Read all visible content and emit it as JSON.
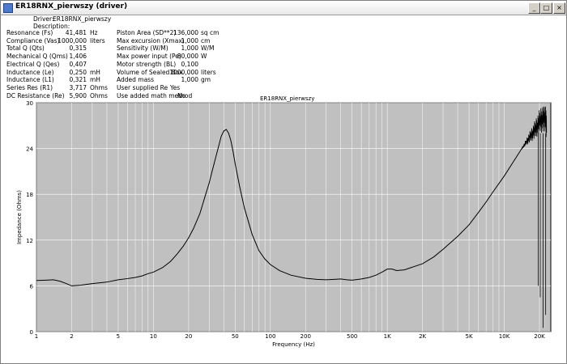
{
  "window": {
    "title": "ER18RNX_pierwszy (driver)",
    "minimize_label": "_",
    "maximize_label": "□",
    "close_label": "×"
  },
  "header": {
    "driver_label": "Driver:",
    "driver_value": "ER18RNX_pierwszy",
    "description_label": "Description:"
  },
  "params_left": [
    {
      "label": "Resonance (Fs)",
      "value": "41,481",
      "unit": "Hz"
    },
    {
      "label": "Compliance (Vas)",
      "value": "1000,000",
      "unit": "liters"
    },
    {
      "label": "Total Q (Qts)",
      "value": "0,315",
      "unit": ""
    },
    {
      "label": "Mechanical Q (Qms)",
      "value": "1,406",
      "unit": ""
    },
    {
      "label": "Electrical Q (Qes)",
      "value": "0,407",
      "unit": ""
    },
    {
      "label": "Inductance (Le)",
      "value": "0,250",
      "unit": "mH"
    },
    {
      "label": "Inductance (L1)",
      "value": "0,321",
      "unit": "mH"
    },
    {
      "label": "Series Res (R1)",
      "value": "3,717",
      "unit": "Ohms"
    },
    {
      "label": "DC Resistance (Re)",
      "value": "5,900",
      "unit": "Ohms"
    }
  ],
  "params_right": [
    {
      "label": "Piston Area (SD**2)",
      "value": "136,000",
      "unit": "sq cm"
    },
    {
      "label": "Max excursion (Xmax)",
      "value": "1,000",
      "unit": "cm"
    },
    {
      "label": "Sensitivity (W/M)",
      "value": "1,000",
      "unit": "W/M"
    },
    {
      "label": "Max power input (Pe)",
      "value": "80,000",
      "unit": "W"
    },
    {
      "label": "Motor strength (BL)",
      "value": "0,100",
      "unit": ""
    },
    {
      "label": "Volume of Sealed Box",
      "value": "1000,000",
      "unit": "liters"
    },
    {
      "label": "Added mass",
      "value": "1,000",
      "unit": "gm"
    },
    {
      "label": "User supplied Re",
      "value": "Yes",
      "unit": ""
    },
    {
      "label": "Use added math method",
      "value": "No",
      "unit": ""
    }
  ],
  "chart_data": {
    "type": "line",
    "title": "ER18RNX_pierwszy",
    "xlabel": "Frequency (Hz)",
    "ylabel": "Impedance (Ohms)",
    "x_scale": "log",
    "xlim": [
      1,
      25000
    ],
    "ylim": [
      0,
      30
    ],
    "grid": true,
    "x_tick_labels": [
      {
        "label": "1",
        "value": 1
      },
      {
        "label": "2",
        "value": 2
      },
      {
        "label": "5",
        "value": 5
      },
      {
        "label": "10",
        "value": 10
      },
      {
        "label": "20",
        "value": 20
      },
      {
        "label": "50",
        "value": 50
      },
      {
        "label": "100",
        "value": 100
      },
      {
        "label": "200",
        "value": 200
      },
      {
        "label": "500",
        "value": 500
      },
      {
        "label": "1K",
        "value": 1000
      },
      {
        "label": "2K",
        "value": 2000
      },
      {
        "label": "5K",
        "value": 5000
      },
      {
        "label": "10K",
        "value": 10000
      },
      {
        "label": "20K",
        "value": 20000
      }
    ],
    "y_tick_labels": [
      {
        "label": "0",
        "value": 0
      },
      {
        "label": "6",
        "value": 6
      },
      {
        "label": "12",
        "value": 12
      },
      {
        "label": "18",
        "value": 18
      },
      {
        "label": "24",
        "value": 24
      },
      {
        "label": "30",
        "value": 30
      }
    ],
    "colors": {
      "plot_bg": "#c0c0c0",
      "grid": "#ffffff",
      "line": "#000000"
    },
    "series": [
      {
        "x": [
          1,
          1.2,
          1.4,
          1.6,
          1.8,
          2,
          2.4,
          3,
          4,
          5,
          6,
          7,
          8,
          9,
          10,
          12,
          14,
          16,
          18,
          20,
          22,
          25,
          28,
          30,
          32,
          35,
          38,
          40,
          42,
          44,
          46,
          48,
          50,
          55,
          60,
          70,
          80,
          90,
          100,
          120,
          150,
          200,
          250,
          300,
          350,
          400,
          450,
          500,
          600,
          700,
          800,
          900,
          1000,
          1100,
          1200,
          1400,
          1600,
          2000,
          2500,
          3000,
          4000,
          5000,
          6000,
          7000,
          8000,
          10000,
          12000,
          14000,
          16000,
          18000,
          20000,
          21000,
          22000,
          23000
        ],
        "y": [
          6.7,
          6.75,
          6.8,
          6.6,
          6.3,
          6.0,
          6.1,
          6.3,
          6.5,
          6.8,
          6.95,
          7.1,
          7.3,
          7.6,
          7.8,
          8.4,
          9.2,
          10.2,
          11.2,
          12.3,
          13.5,
          15.5,
          18.0,
          19.5,
          21.2,
          23.5,
          25.6,
          26.3,
          26.5,
          26.0,
          25.0,
          23.6,
          22.0,
          18.8,
          16.2,
          12.7,
          10.6,
          9.5,
          8.8,
          8.0,
          7.4,
          7.0,
          6.85,
          6.8,
          6.85,
          6.9,
          6.8,
          6.75,
          6.9,
          7.1,
          7.4,
          7.8,
          8.2,
          8.2,
          8.0,
          8.1,
          8.4,
          8.9,
          9.8,
          10.8,
          12.5,
          14.0,
          15.6,
          17.0,
          18.3,
          20.4,
          22.3,
          23.9,
          25.2,
          26.3,
          27.5,
          27.9,
          28.0,
          27.6
        ]
      }
    ]
  }
}
